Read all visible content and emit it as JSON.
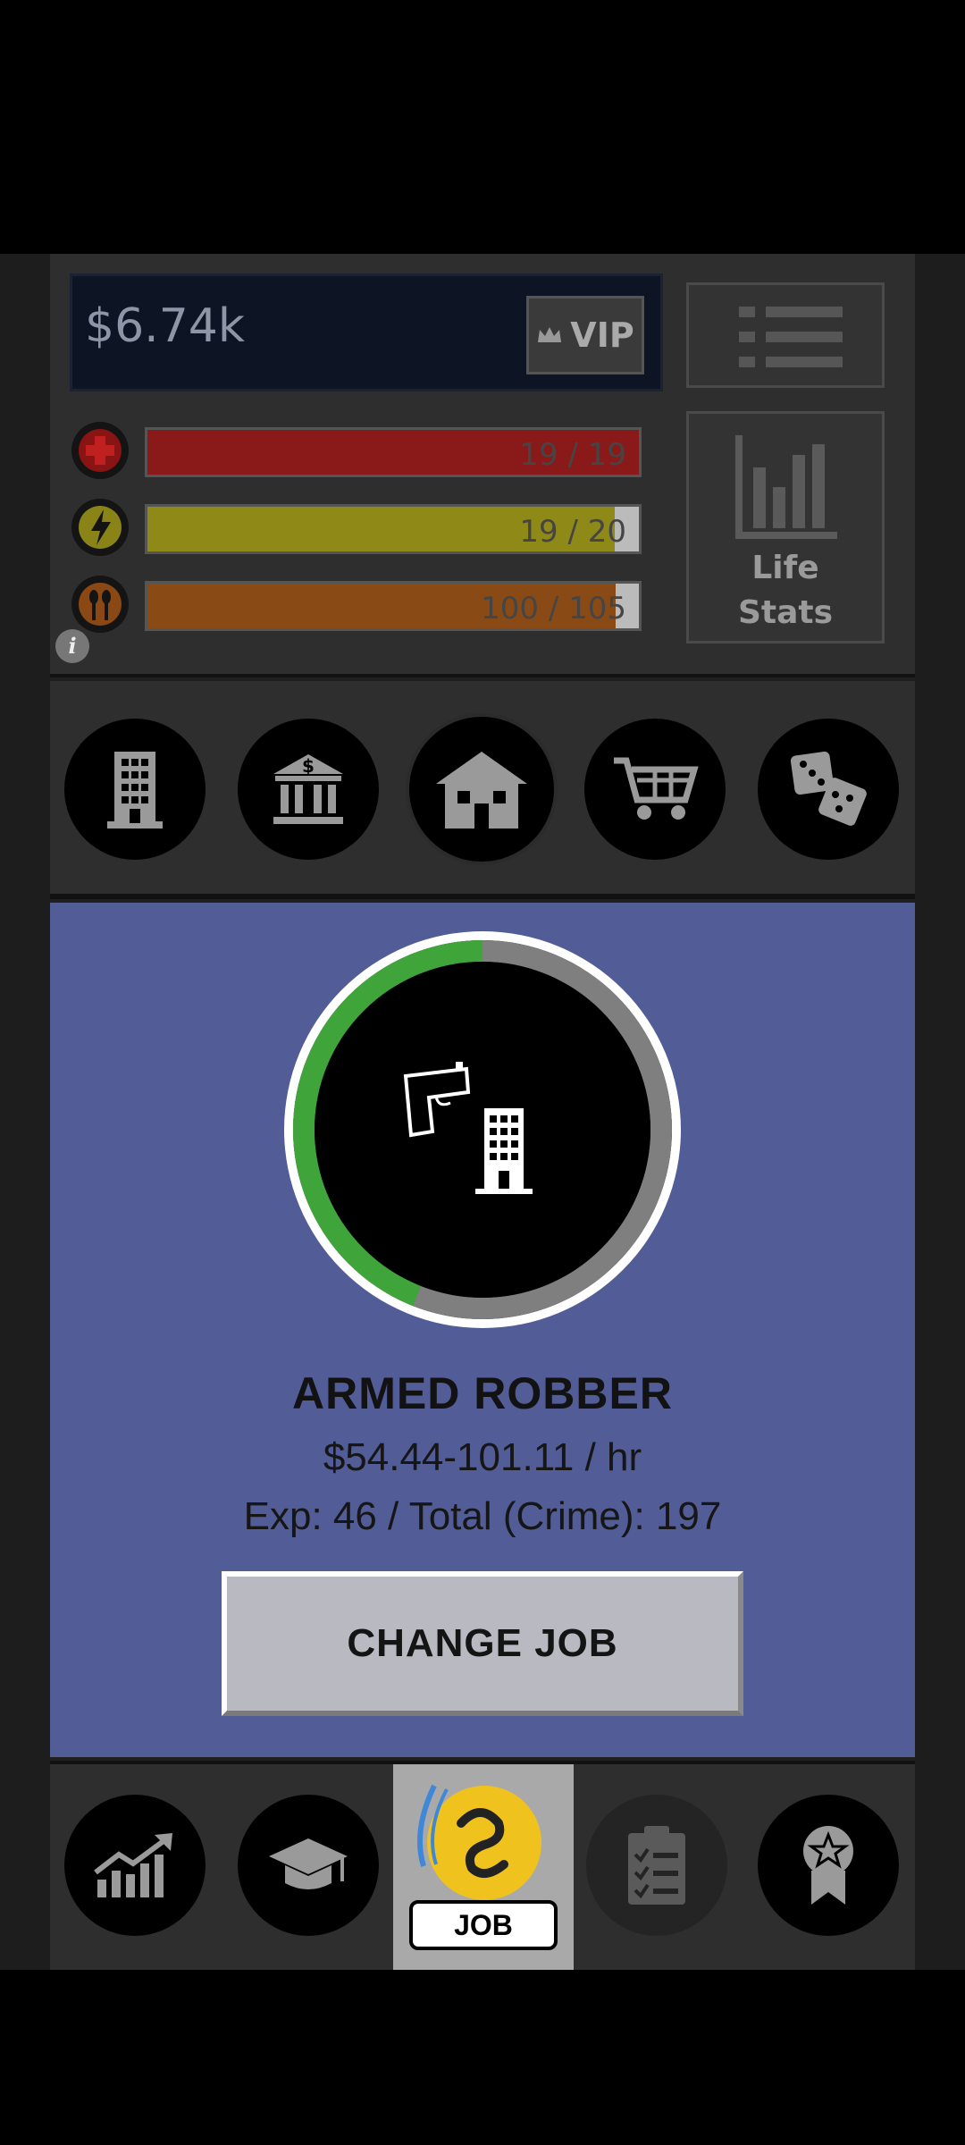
{
  "header": {
    "money": "$6.74k",
    "vip_label": "VIP",
    "life_stats_label": "Life\nStats",
    "stats": [
      {
        "name": "health",
        "text": "19 / 19",
        "fraction": 1.0,
        "color": "#8a1a1a",
        "icon": "health-cross-icon"
      },
      {
        "name": "energy",
        "text": "19 / 20",
        "fraction": 0.95,
        "color": "#8f8a18",
        "icon": "lightning-icon"
      },
      {
        "name": "food",
        "text": "100 / 105",
        "fraction": 0.952,
        "color": "#8a4a16",
        "icon": "utensils-icon"
      }
    ],
    "info_glyph": "i"
  },
  "categories": [
    {
      "name": "work",
      "icon": "building-icon"
    },
    {
      "name": "bank",
      "icon": "bank-icon"
    },
    {
      "name": "home",
      "icon": "house-icon",
      "active": true
    },
    {
      "name": "shop",
      "icon": "cart-icon"
    },
    {
      "name": "casino",
      "icon": "dice-icon"
    }
  ],
  "job": {
    "title": "ARMED ROBBER",
    "pay": "$54.44-101.11 / hr",
    "exp": "Exp: 46 / Total (Crime): 197",
    "progress": 0.44,
    "icon": "gun-building-icon",
    "change_label": "CHANGE JOB",
    "ring_colors": {
      "progress": "#3fa53a",
      "track": "#7f7f7f",
      "border": "#ffffff"
    }
  },
  "bottom_nav": {
    "items": [
      {
        "name": "stocks",
        "icon": "chart-up-icon"
      },
      {
        "name": "education",
        "icon": "graduation-cap-icon"
      },
      {
        "name": "job",
        "icon": "emoji-face-icon",
        "label": "JOB",
        "active": true
      },
      {
        "name": "tasks",
        "icon": "clipboard-icon"
      },
      {
        "name": "achievements",
        "icon": "award-badge-icon"
      }
    ]
  }
}
